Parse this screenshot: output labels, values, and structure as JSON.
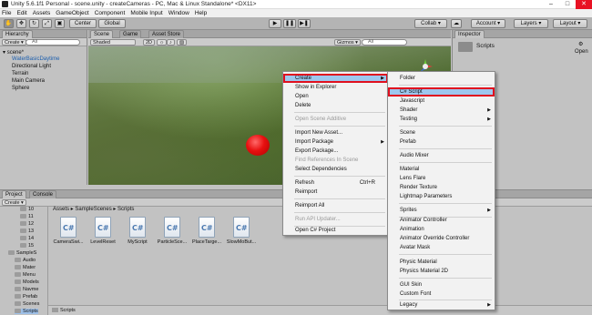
{
  "window": {
    "title": "Unity 5.6.1f1 Personal - scene.unity - createCameras - PC, Mac & Linux Standalone* <DX11>",
    "controls": [
      "–",
      "□",
      "✕"
    ]
  },
  "menubar": [
    "File",
    "Edit",
    "Assets",
    "GameObject",
    "Component",
    "Mobile Input",
    "Window",
    "Help"
  ],
  "toolbar": {
    "pivot": "Center",
    "space": "Global",
    "collab": "Collab ▾",
    "account": "Account ▾",
    "layers": "Layers ▾",
    "layout": "Layout ▾"
  },
  "hierarchy": {
    "tab": "Hierarchy",
    "create": "Create ▾",
    "search_placeholder": "All",
    "scene": "scene*",
    "items": [
      "WaterBasicDaytime",
      "Directional Light",
      "Terrain",
      "Main Camera",
      "Sphere"
    ]
  },
  "scene": {
    "tabs": [
      "Scene",
      "Game",
      "Asset Store"
    ],
    "shading": "Shaded",
    "mode": "2D",
    "gizmos": "Gizmos ▾",
    "search_placeholder": "All"
  },
  "inspector": {
    "tab": "Inspector",
    "name": "Scripts",
    "open": "Open"
  },
  "project": {
    "tabs": [
      "Project",
      "Console"
    ],
    "create": "Create ▾",
    "breadcrumb": "Assets ▸ SampleScenes ▸ Scripts",
    "tree": [
      "10",
      "11",
      "12",
      "13",
      "14",
      "15",
      "SampleS",
      "Audio",
      "Mater",
      "Menu",
      "Models",
      "Navme",
      "Prefab",
      "Scenes",
      "Scripts"
    ],
    "assets": [
      "CameraSwi...",
      "LevelReset",
      "MyScript",
      "ParticleSce...",
      "PlaceTarge...",
      "SlowMoBut..."
    ],
    "footer": "Scripts"
  },
  "context_menu": {
    "items": [
      {
        "label": "Create",
        "highlight": true
      },
      {
        "label": "Show in Explorer"
      },
      {
        "label": "Open"
      },
      {
        "label": "Delete"
      },
      {
        "label": "Open Scene Additive",
        "disabled": true
      },
      {
        "label": "Import New Asset..."
      },
      {
        "label": "Import Package",
        "submenu": true
      },
      {
        "label": "Export Package..."
      },
      {
        "label": "Find References In Scene",
        "disabled": true
      },
      {
        "label": "Select Dependencies"
      },
      {
        "label": "Refresh",
        "shortcut": "Ctrl+R"
      },
      {
        "label": "Reimport"
      },
      {
        "label": "Reimport All"
      },
      {
        "label": "Run API Updater...",
        "disabled": true
      },
      {
        "label": "Open C# Project"
      }
    ]
  },
  "create_submenu": {
    "items": [
      {
        "label": "Folder"
      },
      {
        "label": "C# Script",
        "highlight": true
      },
      {
        "label": "Javascript"
      },
      {
        "label": "Shader",
        "submenu": true
      },
      {
        "label": "Testing",
        "submenu": true
      },
      {
        "label": "Scene"
      },
      {
        "label": "Prefab"
      },
      {
        "label": "Audio Mixer"
      },
      {
        "label": "Material"
      },
      {
        "label": "Lens Flare"
      },
      {
        "label": "Render Texture"
      },
      {
        "label": "Lightmap Parameters"
      },
      {
        "label": "Sprites",
        "submenu": true
      },
      {
        "label": "Animator Controller"
      },
      {
        "label": "Animation"
      },
      {
        "label": "Animator Override Controller"
      },
      {
        "label": "Avatar Mask"
      },
      {
        "label": "Physic Material"
      },
      {
        "label": "Physics Material 2D"
      },
      {
        "label": "GUI Skin"
      },
      {
        "label": "Custom Font"
      },
      {
        "label": "Legacy",
        "submenu": true
      }
    ]
  }
}
